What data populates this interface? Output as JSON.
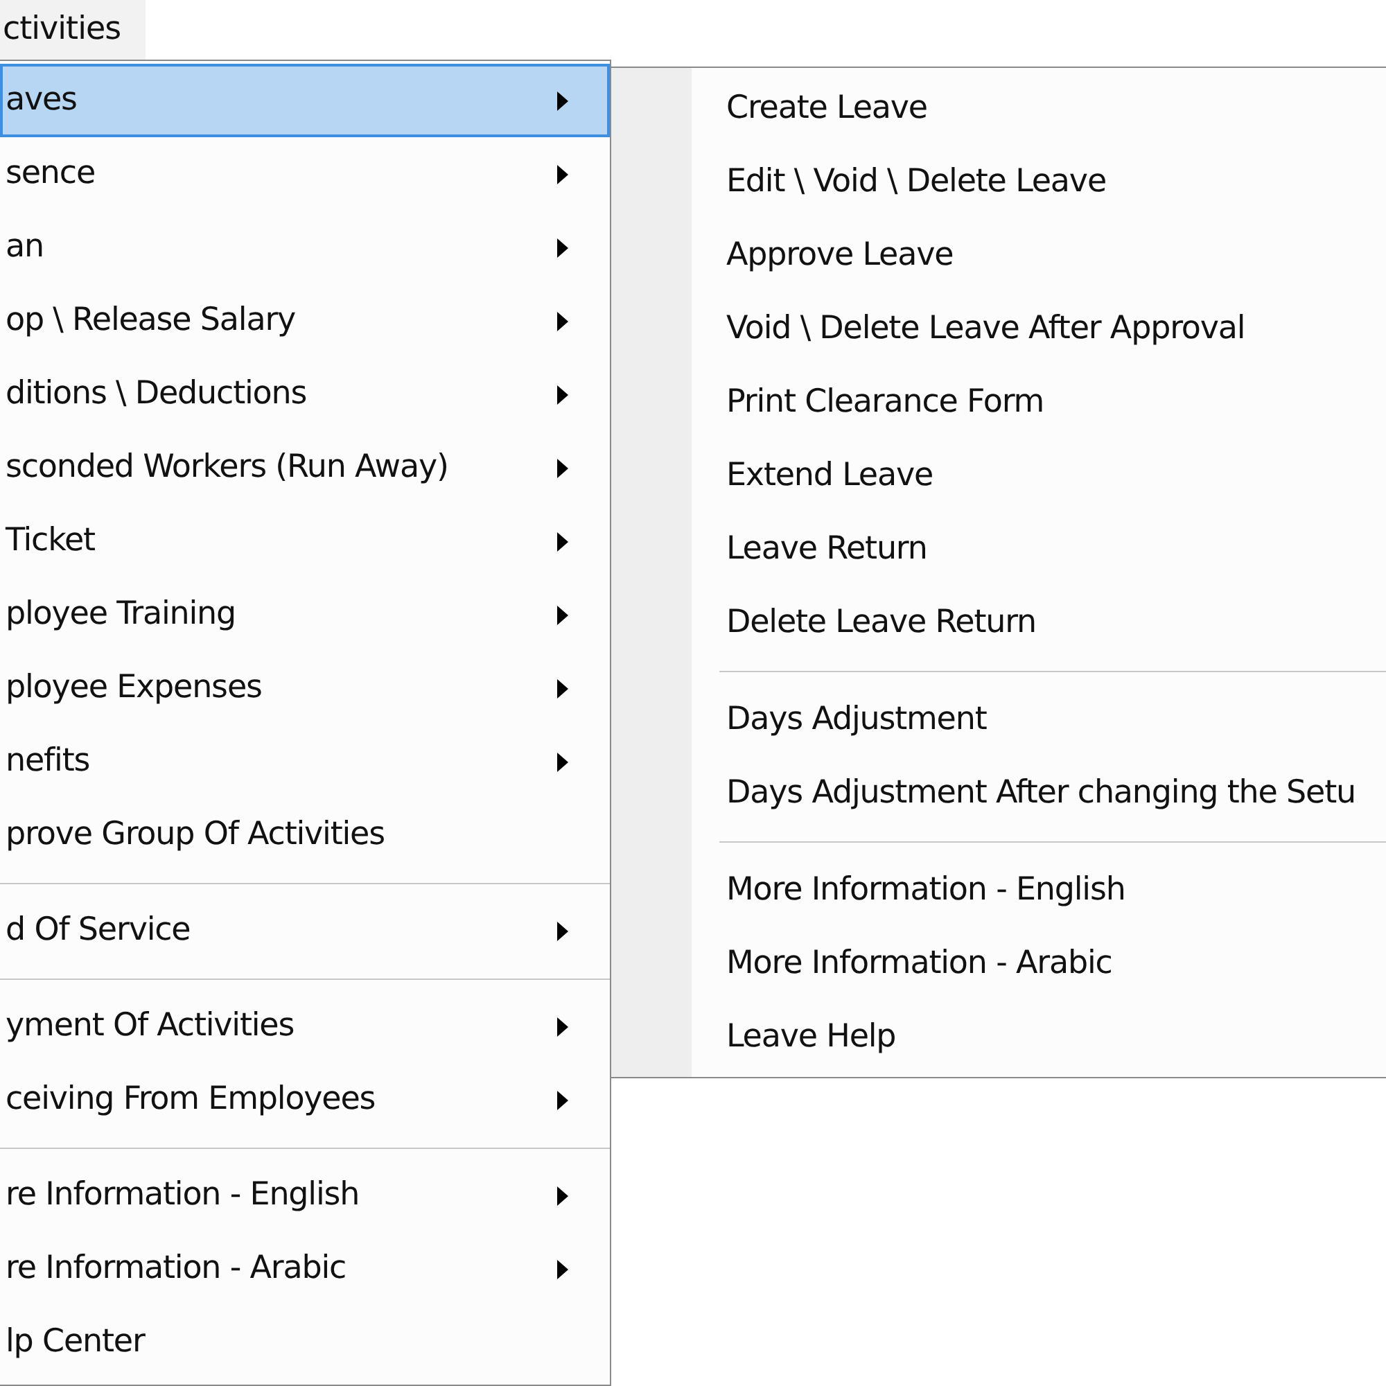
{
  "menu_bar": {
    "title": "ctivities"
  },
  "main_menu": [
    {
      "kind": "item",
      "label": "aves",
      "has_submenu": true,
      "selected": true
    },
    {
      "kind": "item",
      "label": "sence",
      "has_submenu": true,
      "selected": false
    },
    {
      "kind": "item",
      "label": "an",
      "has_submenu": true,
      "selected": false
    },
    {
      "kind": "item",
      "label": "op \\ Release Salary",
      "has_submenu": true,
      "selected": false
    },
    {
      "kind": "item",
      "label": "ditions \\ Deductions",
      "has_submenu": true,
      "selected": false
    },
    {
      "kind": "item",
      "label": "sconded Workers (Run Away)",
      "has_submenu": true,
      "selected": false
    },
    {
      "kind": "item",
      "label": "Ticket",
      "has_submenu": true,
      "selected": false
    },
    {
      "kind": "item",
      "label": "ployee Training",
      "has_submenu": true,
      "selected": false
    },
    {
      "kind": "item",
      "label": "ployee Expenses",
      "has_submenu": true,
      "selected": false
    },
    {
      "kind": "item",
      "label": "nefits",
      "has_submenu": true,
      "selected": false
    },
    {
      "kind": "item",
      "label": "prove Group Of Activities",
      "has_submenu": false,
      "selected": false
    },
    {
      "kind": "separator"
    },
    {
      "kind": "item",
      "label": "d Of Service",
      "has_submenu": true,
      "selected": false
    },
    {
      "kind": "separator"
    },
    {
      "kind": "item",
      "label": "yment Of Activities",
      "has_submenu": true,
      "selected": false
    },
    {
      "kind": "item",
      "label": "ceiving From Employees",
      "has_submenu": true,
      "selected": false
    },
    {
      "kind": "separator"
    },
    {
      "kind": "item",
      "label": "re Information - English",
      "has_submenu": true,
      "selected": false
    },
    {
      "kind": "item",
      "label": "re Information - Arabic",
      "has_submenu": true,
      "selected": false
    },
    {
      "kind": "item",
      "label": "lp Center",
      "has_submenu": false,
      "selected": false
    }
  ],
  "submenu": [
    {
      "kind": "item",
      "label": "Create Leave"
    },
    {
      "kind": "item",
      "label": "Edit \\ Void \\ Delete Leave"
    },
    {
      "kind": "item",
      "label": "Approve Leave"
    },
    {
      "kind": "item",
      "label": "Void \\ Delete Leave After Approval"
    },
    {
      "kind": "item",
      "label": "Print Clearance Form"
    },
    {
      "kind": "item",
      "label": "Extend Leave"
    },
    {
      "kind": "item",
      "label": "Leave Return"
    },
    {
      "kind": "item",
      "label": "Delete Leave Return"
    },
    {
      "kind": "separator"
    },
    {
      "kind": "item",
      "label": "Days Adjustment"
    },
    {
      "kind": "item",
      "label": "Days Adjustment After changing the Setu"
    },
    {
      "kind": "separator"
    },
    {
      "kind": "item",
      "label": "More Information - English"
    },
    {
      "kind": "item",
      "label": "More Information - Arabic"
    },
    {
      "kind": "item",
      "label": "Leave Help"
    }
  ]
}
